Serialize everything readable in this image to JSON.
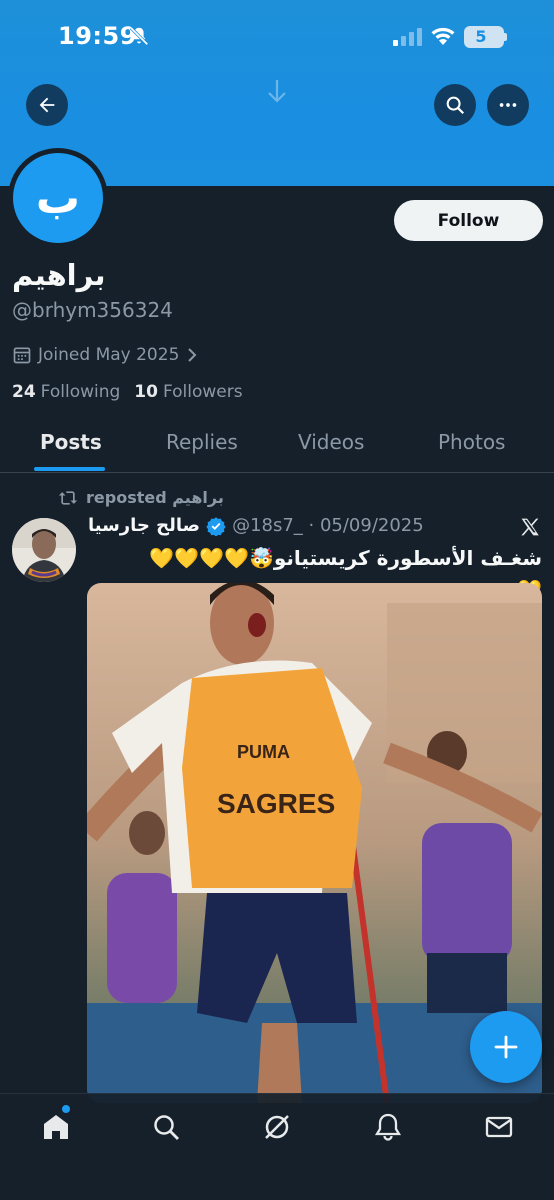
{
  "status_bar": {
    "time": "19:59",
    "battery": "5"
  },
  "header": {
    "back_icon": "arrow-left-icon",
    "search_icon": "search-icon",
    "more_icon": "more-horizontal-icon"
  },
  "profile": {
    "avatar_letter": "ب",
    "avatar_color": "#1d9bf0",
    "display_name": "براهيم",
    "handle": "@brhym356324",
    "joined": "Joined May 2025",
    "following_count": "24",
    "following_label": "Following",
    "followers_count": "10",
    "followers_label": "Followers",
    "follow_button": "Follow"
  },
  "tabs": [
    {
      "label": "Posts",
      "active": true
    },
    {
      "label": "Replies",
      "active": false
    },
    {
      "label": "Videos",
      "active": false
    },
    {
      "label": "Photos",
      "active": false
    }
  ],
  "post": {
    "repost_label": "reposted براهيم",
    "author_name": "صالح جارسيا",
    "verified": true,
    "handle_date": "@18s7_ · 05/09/2025",
    "text": "شغـف الأسطورة كريستيانو🤯💛💛💛💛💛",
    "photo_caption_shirt": "SAGRES"
  },
  "colors": {
    "background": "#15202b",
    "accent": "#1d9bf0",
    "banner": "#1b8fe0"
  },
  "bottom_nav": [
    "home-icon",
    "search-icon",
    "grok-icon",
    "notifications-icon",
    "messages-icon"
  ]
}
